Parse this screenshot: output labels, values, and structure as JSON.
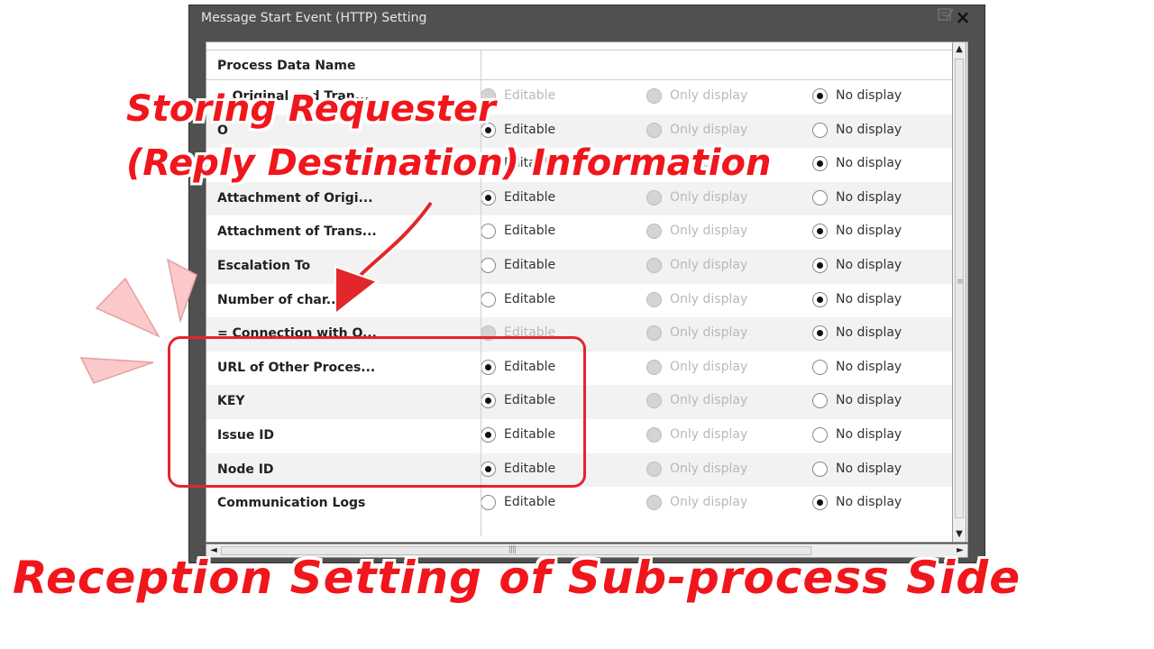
{
  "dialog": {
    "title": "Message Start Event (HTTP) Setting",
    "close_label": "×"
  },
  "table": {
    "header": "Process Data Name",
    "option_labels": {
      "editable": "Editable",
      "only_display": "Only display",
      "no_display": "No display"
    },
    "rows": [
      {
        "name": "= Original and Tran...",
        "selected": "no_display",
        "editable_enabled": false
      },
      {
        "name": "O",
        "selected": "editable",
        "editable_enabled": true
      },
      {
        "name": "Tr",
        "selected": "no_display",
        "editable_enabled": true
      },
      {
        "name": "Attachment of Origi...",
        "selected": "editable",
        "editable_enabled": true
      },
      {
        "name": "Attachment of Trans...",
        "selected": "no_display",
        "editable_enabled": true
      },
      {
        "name": "Escalation  To",
        "selected": "no_display",
        "editable_enabled": true
      },
      {
        "name": "Number of char...",
        "selected": "no_display",
        "editable_enabled": true
      },
      {
        "name": "= Connection with O...",
        "selected": "no_display",
        "editable_enabled": false
      },
      {
        "name": "URL of Other Proces...",
        "selected": "editable",
        "editable_enabled": true
      },
      {
        "name": "KEY",
        "selected": "editable",
        "editable_enabled": true
      },
      {
        "name": "Issue ID",
        "selected": "editable",
        "editable_enabled": true
      },
      {
        "name": "Node ID",
        "selected": "editable",
        "editable_enabled": true
      },
      {
        "name": "Communication Logs",
        "selected": "no_display",
        "editable_enabled": true
      }
    ]
  },
  "annotations": {
    "callout_line1": "Storing Requester",
    "callout_line2": "(Reply Destination) Information",
    "caption": "Reception Setting of Sub-process Side",
    "accent_color": "#f0161c"
  },
  "scrollbar": {
    "up_arrow": "▲",
    "down_arrow": "▼",
    "left_arrow": "◄",
    "right_arrow": "►",
    "grip_v": "≡",
    "grip_h": "||||"
  }
}
